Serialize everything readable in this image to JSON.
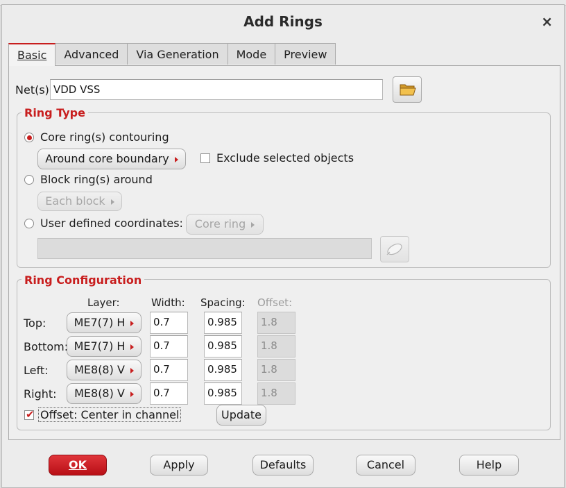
{
  "dialog": {
    "title": "Add Rings",
    "close_glyph": "×"
  },
  "tabs": [
    {
      "label": "Basic",
      "active": true
    },
    {
      "label": "Advanced"
    },
    {
      "label": "Via Generation"
    },
    {
      "label": "Mode"
    },
    {
      "label": "Preview"
    }
  ],
  "nets": {
    "label": "Net(s):",
    "value": "VDD VSS",
    "browse_icon": "folder-icon"
  },
  "ring_type": {
    "legend": "Ring Type",
    "core": {
      "label": "Core ring(s) contouring",
      "selected": true,
      "menu_label": "Around core boundary"
    },
    "exclude": {
      "label": "Exclude selected objects",
      "checked": false
    },
    "block": {
      "label": "Block ring(s) around",
      "selected": false,
      "menu_label": "Each block"
    },
    "user": {
      "label": "User defined coordinates:",
      "selected": false,
      "menu_label": "Core ring",
      "value": ""
    }
  },
  "ring_config": {
    "legend": "Ring Configuration",
    "headers": {
      "layer": "Layer:",
      "width": "Width:",
      "spacing": "Spacing:",
      "offset": "Offset:"
    },
    "rows": [
      {
        "side": "Top:",
        "layer": "ME7(7) H",
        "width": "0.7",
        "spacing": "0.985",
        "offset": "1.8"
      },
      {
        "side": "Bottom:",
        "layer": "ME7(7) H",
        "width": "0.7",
        "spacing": "0.985",
        "offset": "1.8"
      },
      {
        "side": "Left:",
        "layer": "ME8(8) V",
        "width": "0.7",
        "spacing": "0.985",
        "offset": "1.8"
      },
      {
        "side": "Right:",
        "layer": "ME8(8) V",
        "width": "0.7",
        "spacing": "0.985",
        "offset": "1.8"
      }
    ],
    "offset_center": {
      "label": "Offset: Center in channel",
      "checked": true
    },
    "update_label": "Update"
  },
  "buttons": {
    "ok": "OK",
    "apply": "Apply",
    "defaults": "Defaults",
    "cancel": "Cancel",
    "help": "Help"
  },
  "colors": {
    "accent": "#c81e1e",
    "ok_button": "#c8232a"
  }
}
